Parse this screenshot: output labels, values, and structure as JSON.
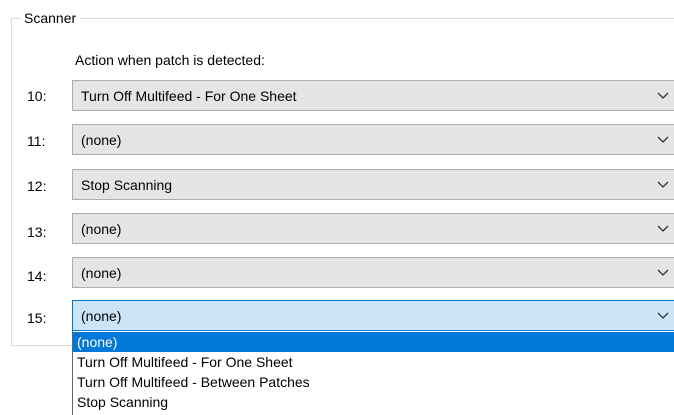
{
  "group": {
    "title": "Scanner"
  },
  "action_label": "Action when patch is detected:",
  "rows": [
    {
      "label": "10:",
      "value": "Turn Off Multifeed - For One Sheet"
    },
    {
      "label": "11:",
      "value": "(none)"
    },
    {
      "label": "12:",
      "value": "Stop Scanning"
    },
    {
      "label": "13:",
      "value": "(none)"
    },
    {
      "label": "14:",
      "value": "(none)"
    },
    {
      "label": "15:",
      "value": "(none)"
    }
  ],
  "dropdown": {
    "options": [
      "(none)",
      "Turn Off Multifeed - For One Sheet",
      "Turn Off Multifeed - Between Patches",
      "Stop Scanning"
    ],
    "selected_index": 0
  },
  "icons": {
    "dropdown_arrow": "chevron-down-icon"
  },
  "colors": {
    "combo_background": "#e5e5e5",
    "combo_focused_background": "#cce4f7",
    "selection_blue": "#0078d7"
  }
}
